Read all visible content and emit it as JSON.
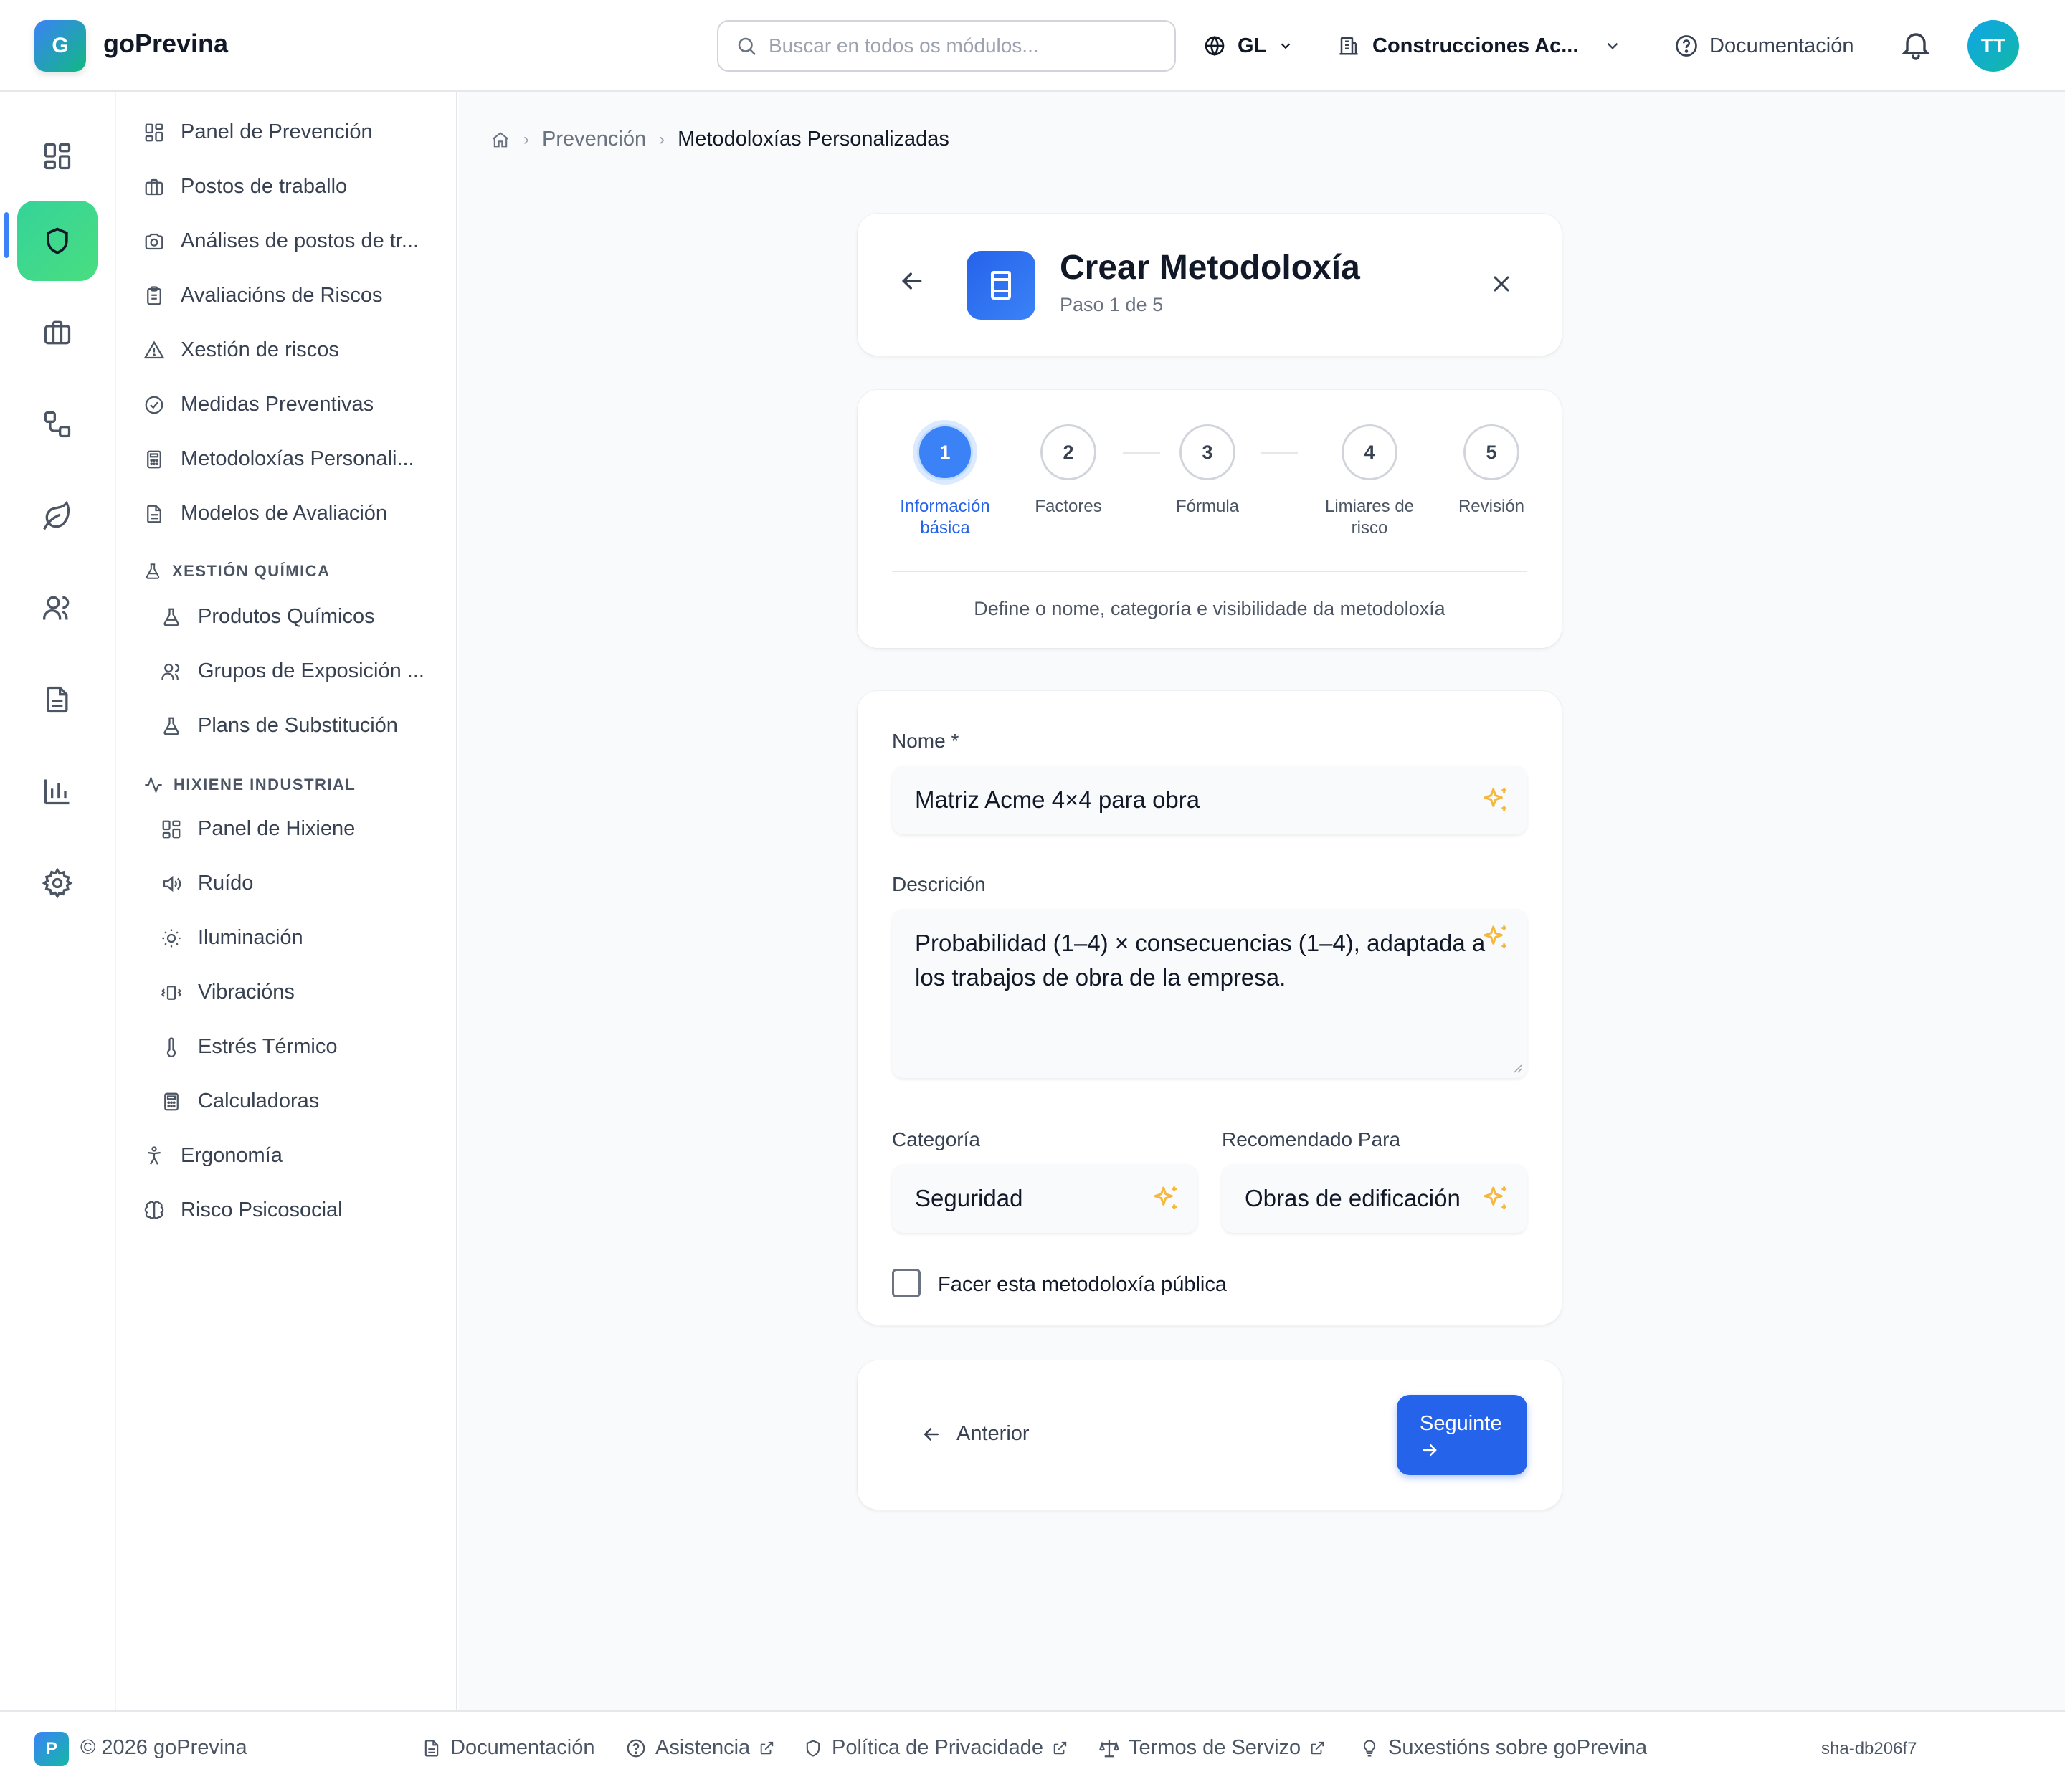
{
  "app": {
    "name": "goPrevina",
    "logo_letter": "G"
  },
  "header": {
    "search_placeholder": "Buscar en todos os módulos...",
    "language": "GL",
    "company": "Construcciones Ac...",
    "docs": "Documentación",
    "avatar_initials": "TT"
  },
  "rail": {
    "items": [
      "dashboard-icon",
      "shield-icon",
      "briefcase-icon",
      "workflow-icon",
      "leaf-icon",
      "users-icon",
      "document-icon",
      "bar-chart-icon",
      "gear-icon"
    ],
    "active": "shield-icon"
  },
  "sidebar": {
    "items": [
      {
        "label": "Panel de Prevención",
        "icon": "grid-icon"
      },
      {
        "label": "Postos de traballo",
        "icon": "briefcase-icon"
      },
      {
        "label": "Análises de postos de tr...",
        "icon": "camera-icon"
      },
      {
        "label": "Avaliacións de Riscos",
        "icon": "clipboard-icon"
      },
      {
        "label": "Xestión de riscos",
        "icon": "warning-icon"
      },
      {
        "label": "Medidas Preventivas",
        "icon": "check-circle-icon"
      },
      {
        "label": "Metodoloxías Personali...",
        "icon": "calculator-icon"
      },
      {
        "label": "Modelos de Avaliación",
        "icon": "file-icon"
      }
    ],
    "chem_section": "XESTIÓN QUÍMICA",
    "chem_items": [
      {
        "label": "Produtos Químicos",
        "icon": "flask-icon"
      },
      {
        "label": "Grupos de Exposición ...",
        "icon": "users-icon"
      },
      {
        "label": "Plans de Substitución",
        "icon": "flask-icon"
      }
    ],
    "hyg_section": "HIXIENE INDUSTRIAL",
    "hyg_items": [
      {
        "label": "Panel de Hixiene",
        "icon": "grid-icon"
      },
      {
        "label": "Ruído",
        "icon": "speaker-icon"
      },
      {
        "label": "Iluminación",
        "icon": "sun-icon"
      },
      {
        "label": "Vibracións",
        "icon": "vibration-icon"
      },
      {
        "label": "Estrés Térmico",
        "icon": "thermometer-icon"
      },
      {
        "label": "Calculadoras",
        "icon": "calculator-icon"
      }
    ],
    "bottom_items": [
      {
        "label": "Ergonomía",
        "icon": "person-icon"
      },
      {
        "label": "Risco Psicosocial",
        "icon": "brain-icon"
      }
    ]
  },
  "breadcrumb": [
    "Prevención",
    "Metodoloxías Personalizadas"
  ],
  "wizard": {
    "title": "Crear Metodoloxía",
    "subtitle": "Paso 1 de 5",
    "steps": [
      {
        "num": "1",
        "label": "Información básica"
      },
      {
        "num": "2",
        "label": "Factores"
      },
      {
        "num": "3",
        "label": "Fórmula"
      },
      {
        "num": "4",
        "label": "Limiares de risco"
      },
      {
        "num": "5",
        "label": "Revisión"
      }
    ],
    "current_step": 1,
    "step_description": "Define o nome, categoría e visibilidade da metodoloxía"
  },
  "form": {
    "name_label": "Nome *",
    "name_value": "Matriz Acme 4×4 para obra",
    "description_label": "Descrición",
    "description_value": "Probabilidad (1–4) × consecuencias (1–4), adaptada a los trabajos de obra de la empresa.",
    "category_label": "Categoría",
    "category_value": "Seguridad",
    "recommended_label": "Recomendado Para",
    "recommended_value": "Obras de edificación",
    "public_label": "Facer esta metodoloxía pública",
    "public_checked": false
  },
  "nav_buttons": {
    "previous": "Anterior",
    "next": "Seguinte"
  },
  "footer": {
    "logo_letter": "P",
    "copyright": "© 2026 goPrevina",
    "links": [
      "Documentación",
      "Asistencia",
      "Política de Privacidade",
      "Termos de Servizo",
      "Suxestións sobre goPrevina"
    ],
    "sha": "sha-db206f7"
  },
  "colors": {
    "accent": "#2563eb",
    "active_rail": "#4ade80",
    "sparkle": "#f5b83d"
  }
}
